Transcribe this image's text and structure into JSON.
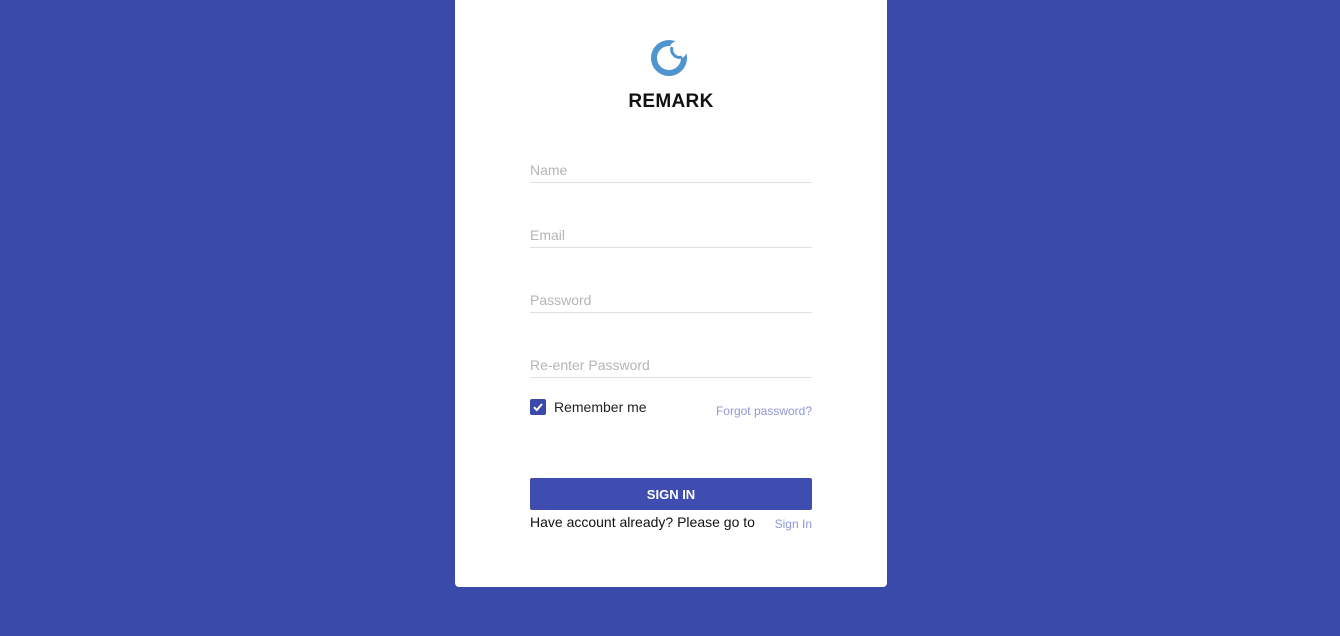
{
  "brand": {
    "name": "REMARK",
    "logo_icon": "remark-logo-icon",
    "logo_colors": [
      "#5aa0d6",
      "#2e78b8"
    ]
  },
  "form": {
    "name_placeholder": "Name",
    "email_placeholder": "Email",
    "password_placeholder": "Password",
    "repassword_placeholder": "Re-enter Password",
    "remember_label": "Remember me",
    "remember_checked": true,
    "forgot_label": "Forgot password?",
    "submit_label": "SIGN IN"
  },
  "footer": {
    "prompt": "Have account already? Please go to",
    "link_label": "Sign In"
  },
  "colors": {
    "background": "#3a4aab",
    "accent": "#3f4db0",
    "link": "#8f97d4"
  }
}
